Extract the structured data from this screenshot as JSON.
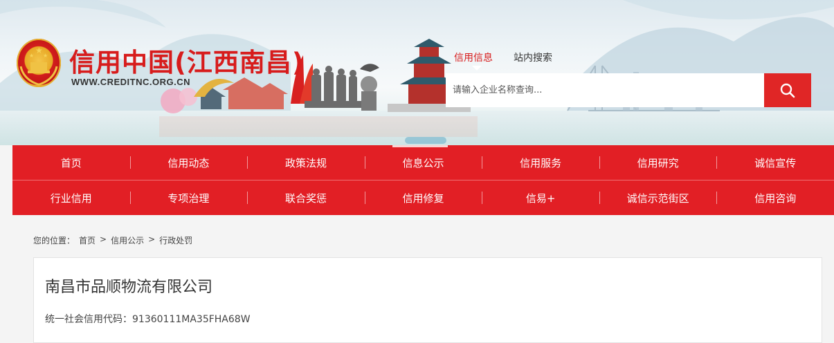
{
  "header": {
    "site_title": "信用中国(江西南昌)",
    "site_url": "WWW.CREDITNC.ORG.CN"
  },
  "search": {
    "tabs": [
      {
        "label": "信用信息",
        "active": true
      },
      {
        "label": "站内搜索",
        "active": false
      }
    ],
    "placeholder": "请输入企业名称查询...",
    "button_icon": "search-icon"
  },
  "nav": {
    "row1": [
      {
        "label": "首页"
      },
      {
        "label": "信用动态"
      },
      {
        "label": "政策法规"
      },
      {
        "label": "信息公示",
        "current": true
      },
      {
        "label": "信用服务"
      },
      {
        "label": "信用研究"
      },
      {
        "label": "诚信宣传"
      }
    ],
    "row2": [
      {
        "label": "行业信用"
      },
      {
        "label": "专项治理"
      },
      {
        "label": "联合奖惩"
      },
      {
        "label": "信用修复"
      },
      {
        "label": "信易+"
      },
      {
        "label": "诚信示范街区"
      },
      {
        "label": "信用咨询"
      }
    ]
  },
  "breadcrumb": {
    "prefix": "您的位置：",
    "items": [
      "首页",
      "信用公示",
      "行政处罚"
    ],
    "separator": ">"
  },
  "company": {
    "name": "南昌市品顺物流有限公司",
    "credit_code_label": "统一社会信用代码：",
    "credit_code": "91360111MA35FHA68W"
  },
  "colors": {
    "brand_red": "#e21f25",
    "title_red": "#d71c1c",
    "page_bg": "#f4f4f4"
  }
}
